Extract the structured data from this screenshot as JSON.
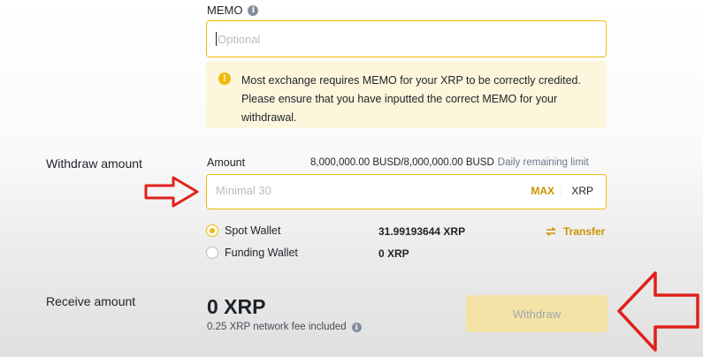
{
  "memo": {
    "label": "MEMO",
    "placeholder": "Optional",
    "warning": "Most exchange requires MEMO for your XRP to be correctly credited. Please ensure that you have inputted the correct MEMO for your withdrawal."
  },
  "withdraw_amount": {
    "row_label": "Withdraw amount",
    "field_label": "Amount",
    "limit_value": "8,000,000.00 BUSD/8,000,000.00 BUSD",
    "limit_caption": "Daily remaining limit",
    "placeholder": "Minimal 30",
    "max_label": "MAX",
    "coin": "XRP"
  },
  "wallets": [
    {
      "label": "Spot Wallet",
      "balance": "31.99193644 XRP",
      "selected": true
    },
    {
      "label": "Funding Wallet",
      "balance": "0 XRP",
      "selected": false
    }
  ],
  "transfer_label": "Transfer",
  "receive": {
    "row_label": "Receive amount",
    "value": "0 XRP",
    "fee_note": "0.25 XRP network fee included"
  },
  "withdraw_button": "Withdraw",
  "colors": {
    "accent": "#f0b90b",
    "accent_text": "#c99400",
    "annotation_arrow": "#e0201c"
  }
}
